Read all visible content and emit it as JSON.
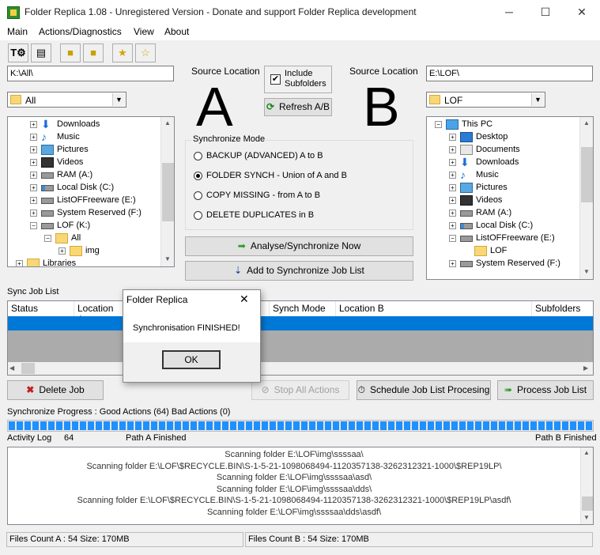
{
  "window": {
    "title": "Folder Replica 1.08 - Unregistered Version - Donate and support Folder Replica development",
    "minimize": "─",
    "maximize": "☐",
    "close": "✕"
  },
  "menu": [
    "Main",
    "Actions/Diagnostics",
    "View",
    "About"
  ],
  "toolbar": [
    "new-job-icon",
    "list-icon",
    "folder-star-icon",
    "folder-up-icon",
    "star-add-icon",
    "star-icon"
  ],
  "left": {
    "path": "K:\\All\\",
    "combo": "All",
    "tree": [
      {
        "label": "Downloads",
        "icon": "download-icon",
        "indent": 0,
        "exp": "+"
      },
      {
        "label": "Music",
        "icon": "music-icon",
        "indent": 0,
        "exp": "+"
      },
      {
        "label": "Pictures",
        "icon": "pictures-icon",
        "indent": 0,
        "exp": "+"
      },
      {
        "label": "Videos",
        "icon": "videos-icon",
        "indent": 0,
        "exp": "+"
      },
      {
        "label": "RAM (A:)",
        "icon": "drive-icon",
        "indent": 0,
        "exp": "+"
      },
      {
        "label": "Local Disk (C:)",
        "icon": "windows-drive-icon",
        "indent": 0,
        "exp": "+"
      },
      {
        "label": "ListOFFreeware (E:)",
        "icon": "drive-icon",
        "indent": 0,
        "exp": "+"
      },
      {
        "label": "System Reserved (F:)",
        "icon": "drive-icon",
        "indent": 0,
        "exp": "+"
      },
      {
        "label": "LOF (K:)",
        "icon": "drive-icon",
        "indent": 0,
        "exp": "−"
      },
      {
        "label": "All",
        "icon": "folder-icon",
        "indent": 1,
        "exp": "−"
      },
      {
        "label": "img",
        "icon": "folder-icon",
        "indent": 2,
        "exp": "+"
      },
      {
        "label": "Libraries",
        "icon": "libraries-icon",
        "indent": -1,
        "exp": "+"
      }
    ]
  },
  "right": {
    "path": "E:\\LOF\\",
    "combo": "LOF",
    "tree": [
      {
        "label": "This PC",
        "icon": "pc-icon",
        "indent": -1,
        "exp": "−"
      },
      {
        "label": "Desktop",
        "icon": "desktop-icon",
        "indent": 0,
        "exp": "+"
      },
      {
        "label": "Documents",
        "icon": "documents-icon",
        "indent": 0,
        "exp": "+"
      },
      {
        "label": "Downloads",
        "icon": "download-icon",
        "indent": 0,
        "exp": "+"
      },
      {
        "label": "Music",
        "icon": "music-icon",
        "indent": 0,
        "exp": "+"
      },
      {
        "label": "Pictures",
        "icon": "pictures-icon",
        "indent": 0,
        "exp": "+"
      },
      {
        "label": "Videos",
        "icon": "videos-icon",
        "indent": 0,
        "exp": "+"
      },
      {
        "label": "RAM (A:)",
        "icon": "drive-icon",
        "indent": 0,
        "exp": "+"
      },
      {
        "label": "Local Disk (C:)",
        "icon": "windows-drive-icon",
        "indent": 0,
        "exp": "+"
      },
      {
        "label": "ListOFFreeware (E:)",
        "icon": "drive-icon",
        "indent": 0,
        "exp": "−"
      },
      {
        "label": "LOF",
        "icon": "folder-icon",
        "indent": 1,
        "exp": ""
      },
      {
        "label": "System Reserved (F:)",
        "icon": "drive-icon",
        "indent": 0,
        "exp": "+"
      }
    ]
  },
  "center": {
    "source_label_a": "Source Location",
    "source_label_b": "Source Location",
    "letter_a": "A",
    "letter_b": "B",
    "include_subfolders": "Include\nSubfolders",
    "include_checked": true,
    "refresh": "Refresh A/B",
    "mode_title": "Synchronize Mode",
    "modes": [
      {
        "label": "BACKUP (ADVANCED) A to B",
        "selected": false
      },
      {
        "label": "FOLDER SYNCH - Union of A and B",
        "selected": true
      },
      {
        "label": "COPY MISSING - from A to B",
        "selected": false
      },
      {
        "label": "DELETE DUPLICATES in B",
        "selected": false
      }
    ],
    "analyse": "Analyse/Synchronize Now",
    "add_job": "Add to Synchronize Job List"
  },
  "jobs": {
    "title": "Sync Job List",
    "columns": [
      "Status",
      "Location A",
      "",
      "Synch Mode",
      "Location B",
      "Subfolders"
    ],
    "delete": "Delete Job",
    "stop": "Stop All Actions",
    "schedule": "Schedule Job List Procesing",
    "process": "Process Job List"
  },
  "progress": {
    "label": "Synchronize Progress : Good Actions (64) Bad Actions (0)",
    "fraction": 1.0,
    "activity": "Activity Log",
    "count": "64",
    "path_a": "Path A Finished",
    "path_b": "Path B Finished"
  },
  "log": [
    "Scanning folder E:\\LOF\\img\\ssssaa\\",
    "Scanning folder E:\\LOF\\$RECYCLE.BIN\\S-1-5-21-1098068494-1120357138-3262312321-1000\\$REP19LP\\",
    "Scanning folder E:\\LOF\\img\\ssssaa\\asd\\",
    "Scanning folder E:\\LOF\\img\\ssssaa\\dds\\",
    "Scanning folder E:\\LOF\\$RECYCLE.BIN\\S-1-5-21-1098068494-1120357138-3262312321-1000\\$REP19LP\\asdf\\",
    "Scanning folder E:\\LOF\\img\\ssssaa\\dds\\asdf\\"
  ],
  "status": {
    "a": "Files Count A : 54  Size: 170MB",
    "b": "Files Count B : 54  Size: 170MB"
  },
  "dialog": {
    "title": "Folder Replica",
    "message": "Synchronisation FINISHED!",
    "ok": "OK",
    "close": "✕"
  },
  "colors": {
    "selection": "#0078d7",
    "progress": "#1e90ff",
    "grid_gray": "#ababab"
  }
}
